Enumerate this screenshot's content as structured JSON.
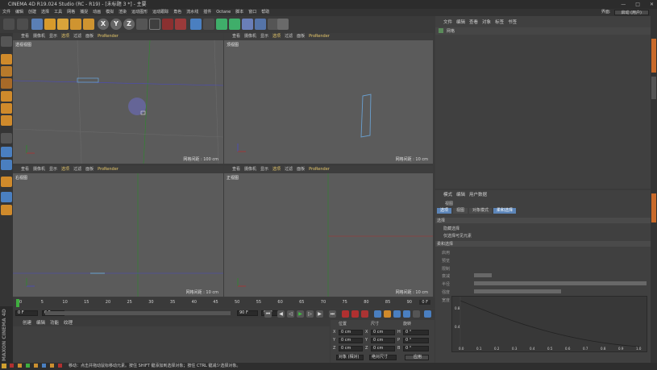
{
  "app": {
    "title": "CINEMA 4D R19.024 Studio (RC - R19) - [未标题 3 *] - 主要",
    "layout_label": "界面:",
    "layout_value": "启动 (用户)"
  },
  "menu": [
    "文件",
    "编辑",
    "创建",
    "选择",
    "工具",
    "网格",
    "捕捉",
    "动画",
    "模拟",
    "渲染",
    "运动图形",
    "运动跟踪",
    "角色",
    "流水线",
    "插件",
    "Octane",
    "脚本",
    "窗口",
    "帮助"
  ],
  "toolbar_axes": [
    "X",
    "Y",
    "Z"
  ],
  "viewport_menu": [
    "查看",
    "摄像机",
    "显示",
    "选项",
    "过滤",
    "面板",
    "ProRender"
  ],
  "viewports": [
    {
      "name": "透视视图",
      "grid": "网格间距 : 100 cm"
    },
    {
      "name": "顶视图",
      "grid": "网格间距 : 10 cm"
    },
    {
      "name": "右视图",
      "grid": "网格间距 : 10 cm"
    },
    {
      "name": "正视图",
      "grid": "网格间距 : 10 cm"
    }
  ],
  "timeline": {
    "ticks": [
      "0",
      "5",
      "10",
      "15",
      "20",
      "25",
      "30",
      "35",
      "40",
      "45",
      "50",
      "55",
      "60",
      "65",
      "70",
      "75",
      "80",
      "85",
      "90"
    ],
    "end_frame": "0 F",
    "start_field": "0 F",
    "current_field": "0 F",
    "end_field": "90 F",
    "max_field": "90 F"
  },
  "materials": {
    "tabs": [
      "创建",
      "编辑",
      "功能",
      "纹理"
    ]
  },
  "coords": {
    "headers": [
      "位置",
      "尺寸",
      "旋转"
    ],
    "rows": [
      {
        "axis": "X",
        "pos": "0 cm",
        "size_axis": "X",
        "size": "0 cm",
        "rot_axis": "H",
        "rot": "0 °"
      },
      {
        "axis": "Y",
        "pos": "0 cm",
        "size_axis": "Y",
        "size": "0 cm",
        "rot_axis": "P",
        "rot": "0 °"
      },
      {
        "axis": "Z",
        "pos": "0 cm",
        "size_axis": "Z",
        "size": "0 cm",
        "rot_axis": "B",
        "rot": "0 °"
      }
    ],
    "mode_select": "对象 (相对)",
    "size_select": "绝对尺寸",
    "apply": "应用"
  },
  "objects": {
    "menu": [
      "文件",
      "编辑",
      "查看",
      "对象",
      "标签",
      "书签"
    ],
    "item_label": "网格"
  },
  "attributes": {
    "menu": [
      "模式",
      "编辑",
      "用户数据"
    ],
    "section": "视图",
    "tabs": [
      "选项",
      "视图",
      "对象模式",
      "柔和选择"
    ],
    "group1": "选择",
    "group1_rows": [
      "隐藏选择",
      "仅选择可见元素"
    ],
    "group2": "柔和选择",
    "group2_rows": [
      "启用",
      "预览",
      "限制",
      "衰减",
      "半径",
      "强度",
      "宽度"
    ]
  },
  "graph_ticks": [
    "0.0",
    "0.1",
    "0.2",
    "0.3",
    "0.4",
    "0.5",
    "0.6",
    "0.7",
    "0.8",
    "0.9",
    "1.0"
  ],
  "graph_yticks": [
    "0.8",
    "0.4"
  ],
  "status": "移动：点击并拖动鼠标移动元素。按住 SHIFT 键添加到选择对象；按住 CTRL 键减少选择对象。",
  "maxon_brand": "MAXON CINEMA 4D",
  "colors": {
    "accent": "#5c85b8",
    "viewport": "#5b5b5b",
    "panel": "#404040"
  }
}
